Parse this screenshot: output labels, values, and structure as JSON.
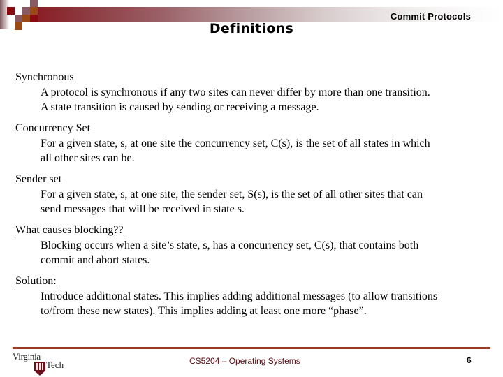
{
  "header": {
    "subtitle": "Commit Protocols",
    "title": "Definitions"
  },
  "colors": {
    "banner_dark": "#8a1a22",
    "logo_red": "#8b0a12",
    "logo_mauve": "#8a5a63",
    "logo_brown": "#9a4a15",
    "footer_rule": "#9b3a22",
    "footer_text": "#5a0a12"
  },
  "sections": [
    {
      "heading": "Synchronous",
      "lines": [
        "A protocol is synchronous if any two sites can never differ by more than one transition.",
        "A state transition is caused by sending or receiving a message."
      ]
    },
    {
      "heading": "Concurrency Set",
      "lines": [
        "For a given state, s, at one site the concurrency set, C(s), is the set of all states in which",
        "all other sites can be."
      ]
    },
    {
      "heading": "Sender set",
      "lines": [
        "For a given state, s, at one site, the sender set, S(s), is the set of all other sites that can",
        "send messages that will be received in state s."
      ]
    },
    {
      "heading": "What causes blocking??",
      "lines": [
        "Blocking occurs when a site’s state, s, has a concurrency set, C(s), that contains both",
        "commit and abort states."
      ]
    },
    {
      "heading": "Solution:",
      "lines": [
        "Introduce additional states. This implies adding additional messages (to allow transitions",
        "to/from these new states). This implies adding at least one more “phase”."
      ]
    }
  ],
  "footer": {
    "logo": {
      "line1": "Virginia",
      "line2": "Tech",
      "icon": "shield-icon"
    },
    "course": "CS5204 – Operating Systems",
    "page_number": "6"
  }
}
